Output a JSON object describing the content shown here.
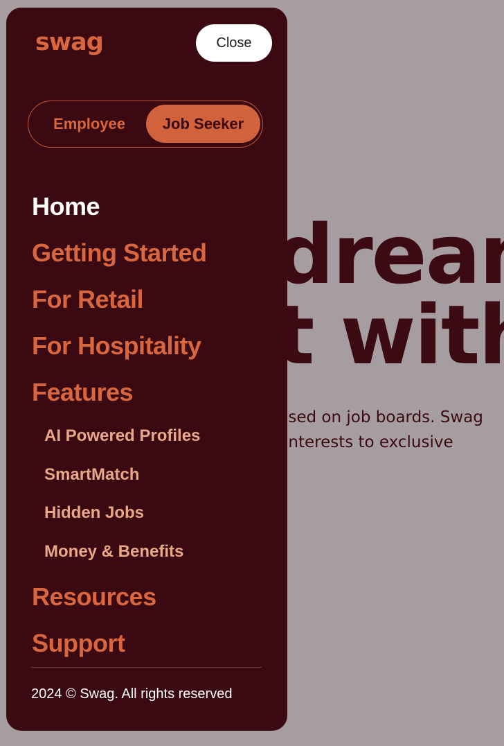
{
  "background": {
    "hero_line1": "dream",
    "hero_line2": "t with",
    "para_line1": "ised on job boards. Swag",
    "para_line2": "interests to exclusive"
  },
  "drawer": {
    "logo": "swag",
    "close_label": "Close",
    "toggle": {
      "options": [
        "Employee",
        "Job Seeker"
      ],
      "selected": "Job Seeker"
    },
    "nav": {
      "home": "Home",
      "getting_started": "Getting Started",
      "for_retail": "For Retail",
      "for_hospitality": "For Hospitality",
      "features": "Features",
      "features_sub": [
        "AI Powered Profiles",
        "SmartMatch",
        "Hidden Jobs",
        "Money & Benefits"
      ],
      "resources": "Resources",
      "support": "Support"
    },
    "footer": "2024 © Swag. All rights reserved"
  },
  "colors": {
    "drawer_bg": "#3b0912",
    "accent": "#d2623c",
    "overlay_bg": "#a69da1",
    "active_nav": "#ffffff",
    "sub_nav": "#e9a888"
  }
}
